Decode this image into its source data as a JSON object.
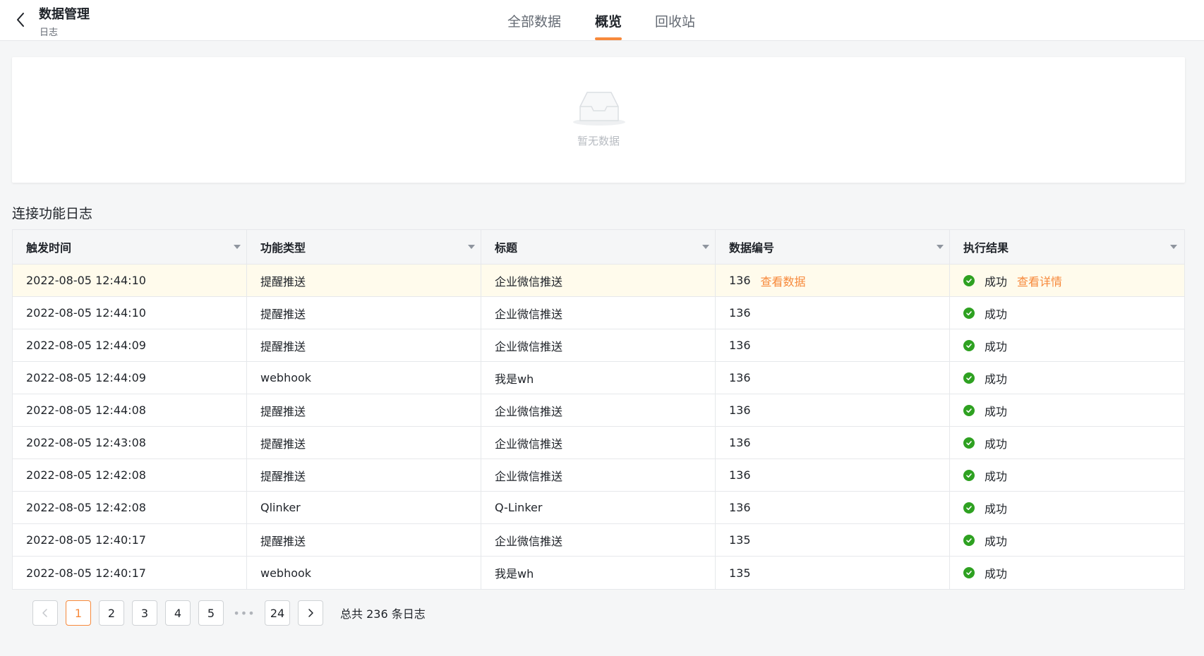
{
  "header": {
    "title": "数据管理",
    "subtitle": "日志",
    "tabs": [
      {
        "label": "全部数据",
        "active": false
      },
      {
        "label": "概览",
        "active": true
      },
      {
        "label": "回收站",
        "active": false
      }
    ]
  },
  "overview": {
    "empty_text": "暂无数据"
  },
  "section_title": "连接功能日志",
  "table": {
    "columns": [
      "触发时间",
      "功能类型",
      "标题",
      "数据编号",
      "执行结果"
    ],
    "rows": [
      {
        "time": "2022-08-05 12:44:10",
        "type": "提醒推送",
        "title": "企业微信推送",
        "id": "136",
        "id_link": "查看数据",
        "status": "成功",
        "status_link": "查看详情",
        "highlight": true
      },
      {
        "time": "2022-08-05 12:44:10",
        "type": "提醒推送",
        "title": "企业微信推送",
        "id": "136",
        "status": "成功"
      },
      {
        "time": "2022-08-05 12:44:09",
        "type": "提醒推送",
        "title": "企业微信推送",
        "id": "136",
        "status": "成功"
      },
      {
        "time": "2022-08-05 12:44:09",
        "type": "webhook",
        "title": "我是wh",
        "id": "136",
        "status": "成功"
      },
      {
        "time": "2022-08-05 12:44:08",
        "type": "提醒推送",
        "title": "企业微信推送",
        "id": "136",
        "status": "成功"
      },
      {
        "time": "2022-08-05 12:43:08",
        "type": "提醒推送",
        "title": "企业微信推送",
        "id": "136",
        "status": "成功"
      },
      {
        "time": "2022-08-05 12:42:08",
        "type": "提醒推送",
        "title": "企业微信推送",
        "id": "136",
        "status": "成功"
      },
      {
        "time": "2022-08-05 12:42:08",
        "type": "Qlinker",
        "title": "Q-Linker",
        "id": "136",
        "status": "成功"
      },
      {
        "time": "2022-08-05 12:40:17",
        "type": "提醒推送",
        "title": "企业微信推送",
        "id": "135",
        "status": "成功"
      },
      {
        "time": "2022-08-05 12:40:17",
        "type": "webhook",
        "title": "我是wh",
        "id": "135",
        "status": "成功"
      }
    ]
  },
  "pagination": {
    "prev_icon": "chevron-left-icon",
    "pages": [
      "1",
      "2",
      "3",
      "4",
      "5"
    ],
    "current": "1",
    "ellipsis": "•••",
    "last": "24",
    "next_icon": "chevron-right-icon",
    "total_text": "总共 236 条日志"
  },
  "colors": {
    "accent": "#f7893b",
    "success": "#2ea121",
    "highlight_row": "#fffbec"
  }
}
